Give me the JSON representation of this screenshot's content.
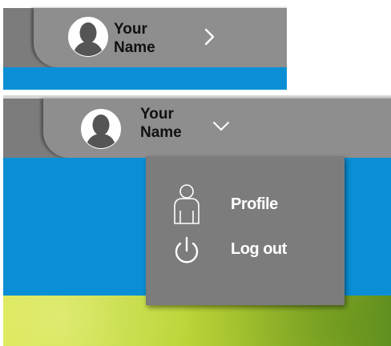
{
  "top_panel": {
    "user_name_line1": "Your",
    "user_name_line2": "Name",
    "avatar_icon": "user-silhouette-icon",
    "toggle_icon": "chevron-right-icon"
  },
  "bottom_panel": {
    "user_name_line1": "Your",
    "user_name_line2": "Name",
    "avatar_icon": "user-silhouette-icon",
    "toggle_icon": "chevron-down-icon",
    "menu": [
      {
        "label": "Profile",
        "icon": "user-outline-icon"
      },
      {
        "label": "Log out",
        "icon": "power-icon"
      }
    ]
  },
  "colors": {
    "header_dark": "#7c7c7c",
    "header_tab": "#8e8e8e",
    "accent_blue": "#0a8fd6",
    "dropdown_bg": "#7c7c7c",
    "menu_text": "#ffffff"
  }
}
